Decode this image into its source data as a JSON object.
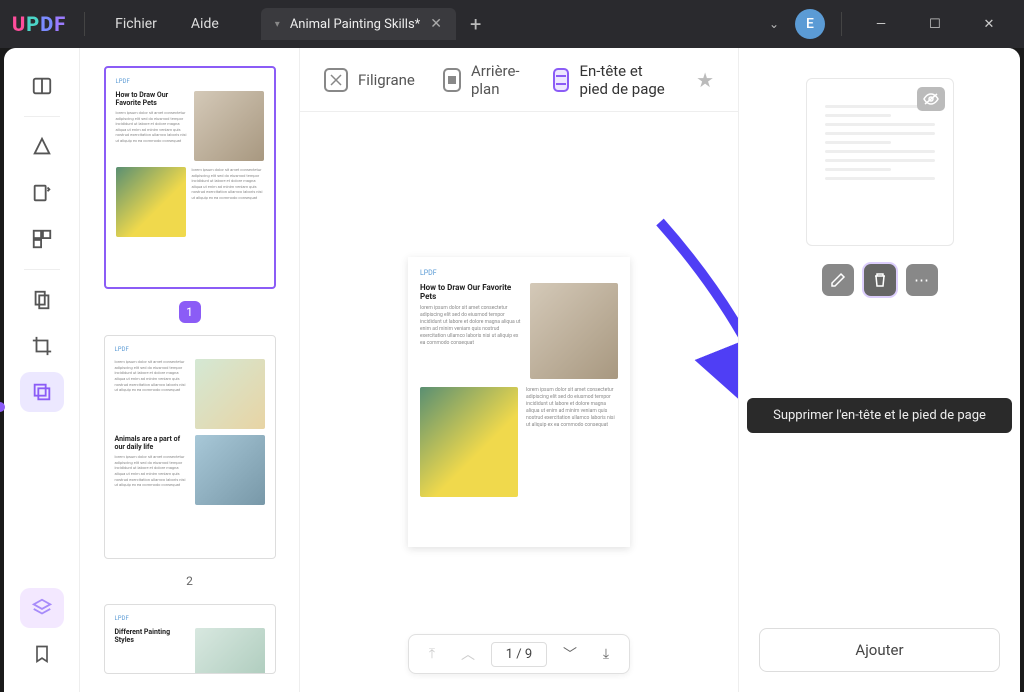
{
  "menu": {
    "file": "Fichier",
    "help": "Aide"
  },
  "tab": {
    "title": "Animal Painting Skills*"
  },
  "user": {
    "initial": "E"
  },
  "tools": {
    "watermark": "Filigrane",
    "background": "Arrière-plan",
    "header_footer": "En-tête et pied de page"
  },
  "doc": {
    "header": "LPDF",
    "title": "How to Draw Our Favorite Pets",
    "para_lines": "lorem ipsum dolor sit amet consectetur adipiscing elit sed do eiusmod tempor incididunt ut labore et dolore magna aliqua ut enim ad minim veniam quis nostrud exercitation ullamco laboris nisi ut aliquip ex ea commodo consequat"
  },
  "thumb2": {
    "title": "Animals are a part of our daily life"
  },
  "thumb3": {
    "title": "Different Painting Styles"
  },
  "nav": {
    "page_display": "1 / 9"
  },
  "panel": {
    "tooltip": "Supprimer l'en-tête et le pied de page",
    "add_button": "Ajouter"
  },
  "thumbs": {
    "page1": "1",
    "page2": "2"
  }
}
